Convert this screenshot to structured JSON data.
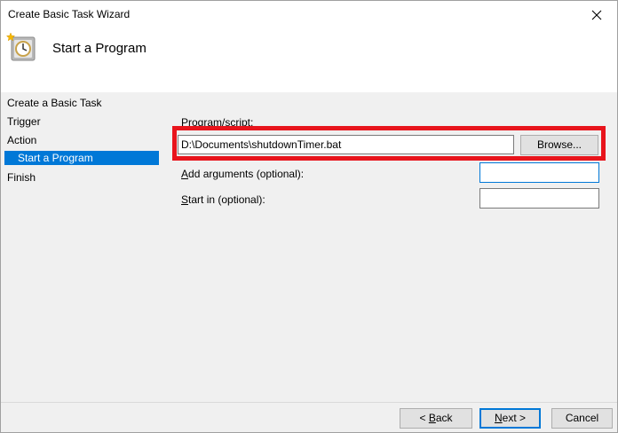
{
  "window": {
    "title": "Create Basic Task Wizard"
  },
  "header": {
    "title": "Start a Program",
    "icon": "task-scheduler-clock-icon"
  },
  "steps": [
    {
      "label": "Create a Basic Task"
    },
    {
      "label": "Trigger"
    },
    {
      "label": "Action"
    },
    {
      "label": "Start a Program",
      "active": true
    },
    {
      "label": "Finish"
    }
  ],
  "form": {
    "program_label": "Program/script:",
    "program_value": "D:\\Documents\\shutdownTimer.bat",
    "browse_label": "Browse...",
    "arguments_label_accel": "A",
    "arguments_label_rest": "dd arguments (optional):",
    "arguments_value": "",
    "start_in_label_accel": "S",
    "start_in_label_rest": "tart in (optional):",
    "start_in_value": ""
  },
  "footer": {
    "back_arrow": "< ",
    "back_accel": "B",
    "back_rest": "ack",
    "next_accel": "N",
    "next_rest": "ext >",
    "cancel_label": "Cancel"
  },
  "colors": {
    "highlight": "#e8141c",
    "selection": "#0078d7"
  }
}
